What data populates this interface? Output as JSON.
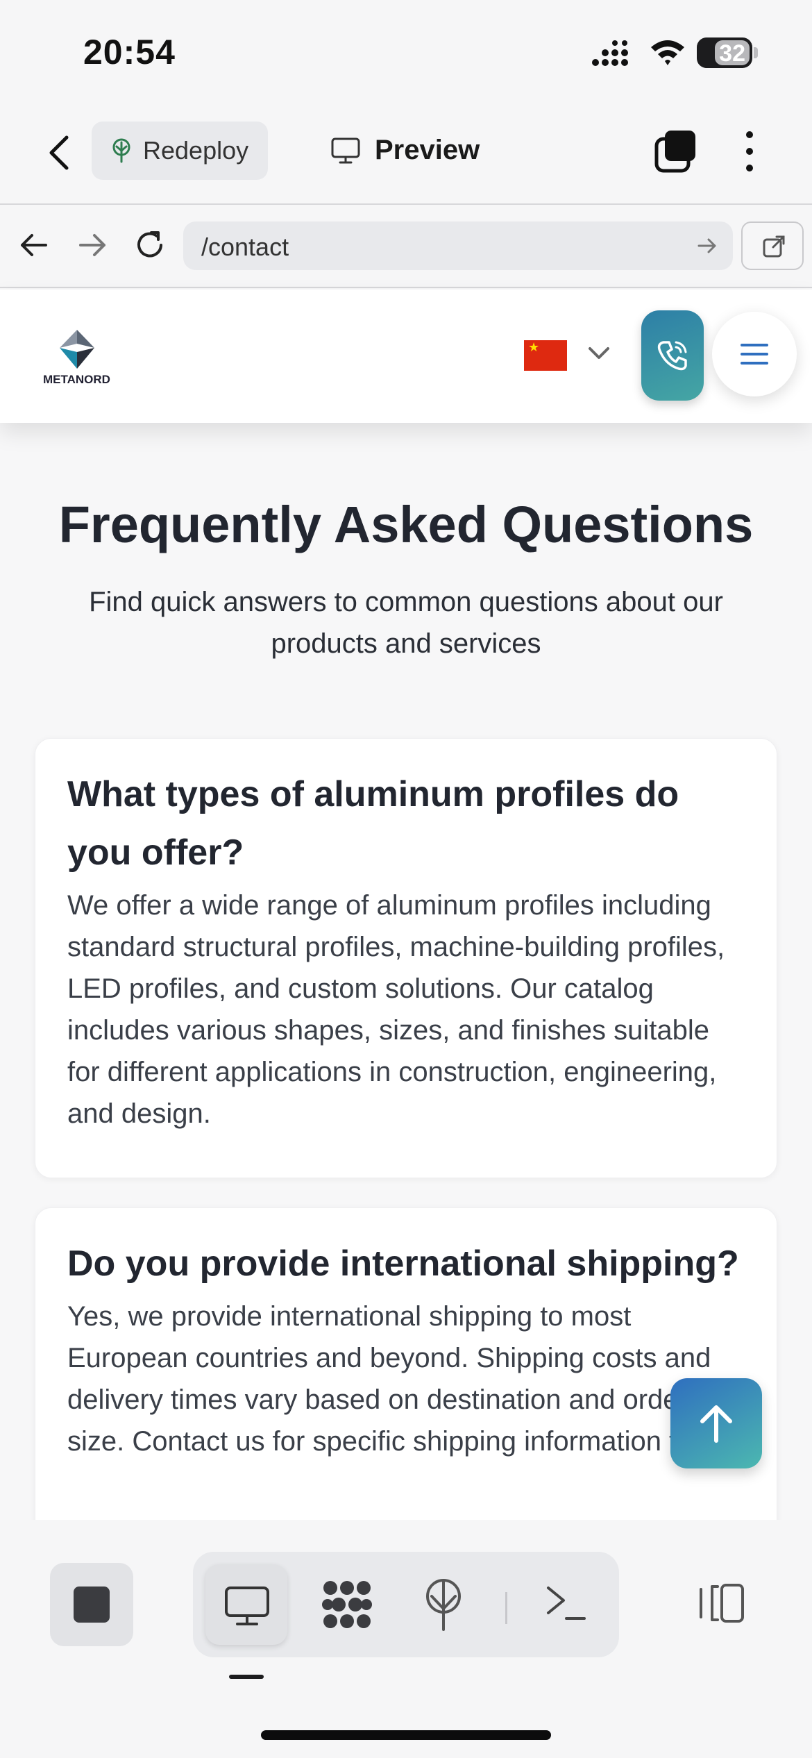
{
  "status_bar": {
    "time": "20:54",
    "battery": "32"
  },
  "app_bar": {
    "redeploy_label": "Redeploy",
    "preview_label": "Preview"
  },
  "url_bar": {
    "path": "/contact"
  },
  "site_header": {
    "logo_text": "METANORD",
    "language": "Chinese"
  },
  "faq": {
    "title": "Frequently Asked Questions",
    "subtitle": "Find quick answers to common questions about our products and services",
    "items": [
      {
        "question": "What types of aluminum profiles do you offer?",
        "answer": "We offer a wide range of aluminum profiles including standard structural profiles, machine-building profiles, LED profiles, and custom solutions. Our catalog includes various shapes, sizes, and finishes suitable for different applications in construction, engineering, and design."
      },
      {
        "question": "Do you provide international shipping?",
        "answer": "Yes, we provide international shipping to most European countries and beyond. Shipping costs and delivery times vary based on destination and order size. Contact us for specific shipping information for"
      }
    ]
  },
  "colors": {
    "accent_teal": "#45a6a4",
    "accent_blue": "#2f6fbf",
    "menu_blue": "#2f6fbf"
  },
  "icons": [
    "back-chevron-icon",
    "sprout-icon",
    "monitor-icon",
    "tabs-icon",
    "more-vertical-icon",
    "arrow-left-icon",
    "arrow-right-icon",
    "reload-icon",
    "external-link-icon",
    "phone-icon",
    "hamburger-icon",
    "arrow-up-icon",
    "stop-icon",
    "grid-icon",
    "antenna-icon",
    "terminal-icon",
    "side-panel-icon"
  ]
}
